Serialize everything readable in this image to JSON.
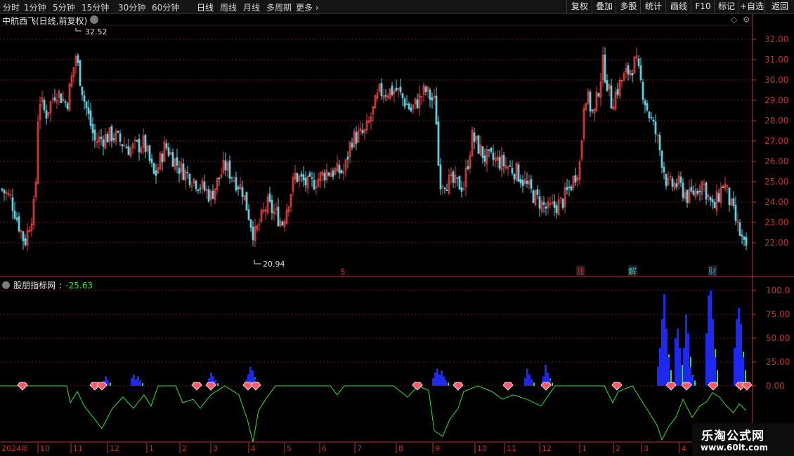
{
  "toolbar": {
    "timeframes": [
      "分时",
      "1分钟",
      "5分钟",
      "15分钟",
      "30分钟",
      "60分钟",
      "日线",
      "周线",
      "月线",
      "多周期",
      "更多"
    ],
    "right_buttons": [
      "复权",
      "叠加",
      "多股",
      "统计",
      "画线",
      "F10",
      "标记",
      "+自选",
      "返回"
    ]
  },
  "main_chart": {
    "title": "中航西飞(日线,前复权)",
    "high_label": "32.52",
    "low_label": "20.94",
    "price_axis": [
      "32.00",
      "31.00",
      "30.00",
      "29.00",
      "28.00",
      "27.00",
      "26.00",
      "25.00",
      "24.00",
      "23.00",
      "22.00"
    ],
    "event_markers": [
      "$",
      "涨",
      "解",
      "财"
    ],
    "colors": {
      "up": "#e03c3c",
      "down": "#5fd0e0",
      "grid": "#6a1e1e",
      "axis": "#c83232"
    }
  },
  "indicator": {
    "name": "股朋指标网",
    "value": "-25.63",
    "axis": [
      "100.0",
      "75.00",
      "50.00",
      "25.00",
      "0.00"
    ],
    "colors": {
      "line": "#32e632",
      "blue": "#1e28f0",
      "green": "#32e632",
      "value": "#32e632"
    }
  },
  "x_axis": [
    "2024年",
    "10",
    "11",
    "12",
    "1",
    "2",
    "3",
    "4",
    "5",
    "6",
    "7",
    "8",
    "9",
    "10",
    "11",
    "12",
    "1",
    "2",
    "3",
    "4"
  ],
  "watermark": {
    "title": "乐淘公式网",
    "url": "www.60lt.com"
  }
}
